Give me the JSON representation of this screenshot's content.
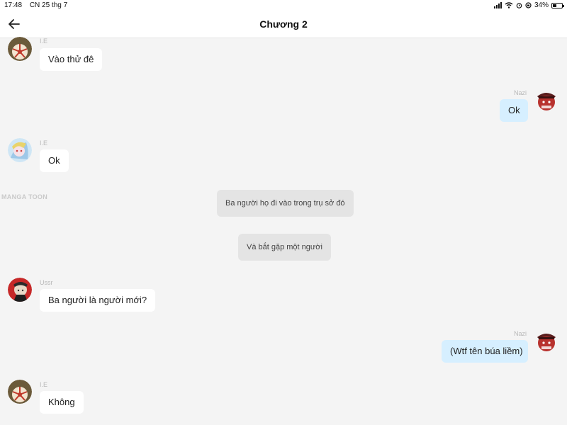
{
  "status": {
    "time": "17:48",
    "date": "CN 25 thg 7",
    "battery": "34%"
  },
  "header": {
    "title": "Chương 2"
  },
  "watermark": "MANGA TOON",
  "messages": [
    {
      "sender": "I.E",
      "text": "Vào thử đê"
    },
    {
      "sender": "Nazi",
      "text": "Ok"
    },
    {
      "sender": "I.E",
      "text": "Ok"
    },
    {
      "sender": "Ussr",
      "text": "Ba người là người mới?"
    },
    {
      "sender": "Nazi",
      "text": "(Wtf tên búa liềm)"
    },
    {
      "sender": "I.E",
      "text": "Không"
    }
  ],
  "narration": [
    "Ba người họ đi vào trong trụ sở đó",
    "Và bắt gặp một người"
  ],
  "colors": {
    "right_bubble": "#d6efff",
    "left_bubble": "#ffffff",
    "narration_bg": "#e4e4e4",
    "background": "#f4f4f4"
  }
}
